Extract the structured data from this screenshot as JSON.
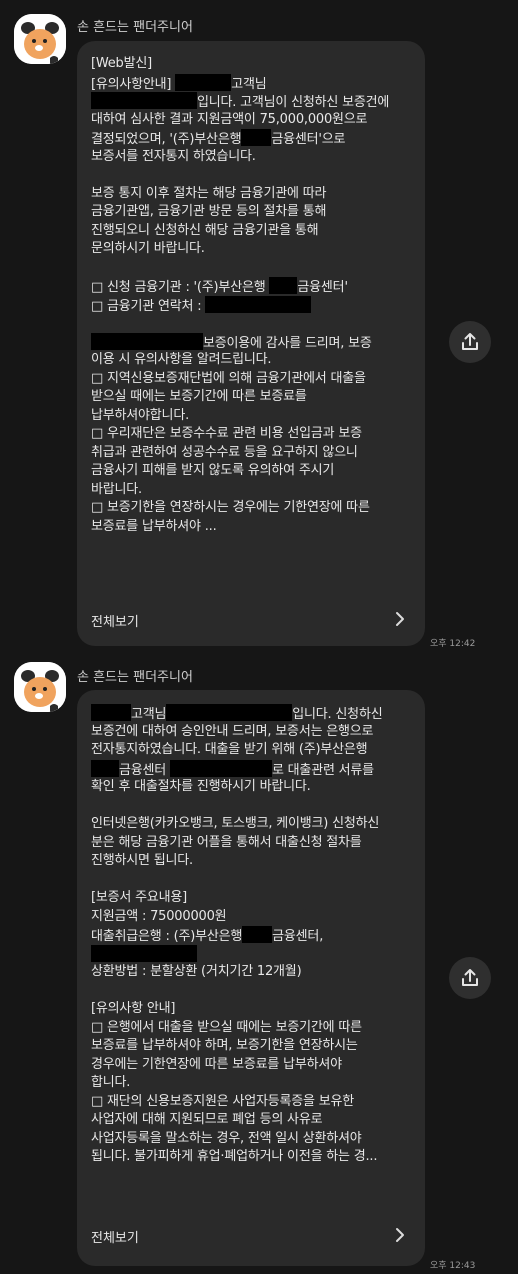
{
  "messages": [
    {
      "sender": "손 흔드는 팬더주니어",
      "time": "오후 12:42",
      "see_all": "전체보기",
      "lines": [
        [
          "[Web발신]"
        ],
        [
          "[유의사항안내] ",
          "R",
          "고객님"
        ],
        [
          "R",
          "입니다. 고객님이 신청하신 보증건에"
        ],
        [
          "대하여 심사한 결과 지원금액이 75,000,000원으로"
        ],
        [
          "결정되었으며, '(주)부산은행",
          "R",
          "금융센터'으로"
        ],
        [
          "보증서를 전자통지 하였습니다."
        ],
        [
          ""
        ],
        [
          "보증 통지 이후 절차는 해당 금융기관에 따라"
        ],
        [
          "금융기관앱, 금융기관 방문 등의 절차를 통해"
        ],
        [
          "진행되오니 신청하신 해당 금융기관을 통해"
        ],
        [
          "문의하시기 바랍니다."
        ],
        [
          ""
        ],
        [
          "□ 신청 금융기관 : '(주)부산은행 ",
          "R",
          "금융센터'"
        ],
        [
          "□ 금융기관 연락처 : ",
          "R"
        ],
        [
          ""
        ],
        [
          "R",
          "보증이용에 감사를 드리며, 보증"
        ],
        [
          "이용 시 유의사항을 알려드립니다."
        ],
        [
          "□ 지역신용보증재단법에 의해 금융기관에서 대출을"
        ],
        [
          "받으실 때에는 보증기간에 따른 보증료를"
        ],
        [
          "납부하셔야합니다."
        ],
        [
          "□ 우리재단은 보증수수료 관련 비용 선입금과 보증"
        ],
        [
          "취급과 관련하여 성공수수료 등을 요구하지 않으니"
        ],
        [
          "금융사기 피해를 받지 않도록 유의하여 주시기"
        ],
        [
          "바랍니다."
        ],
        [
          "□ 보증기한을 연장하시는 경우에는 기한연장에 따른"
        ],
        [
          "보증료를 납부하셔야 ..."
        ]
      ]
    },
    {
      "sender": "손 흔드는 팬더주니어",
      "time": "오후 12:43",
      "see_all": "전체보기",
      "lines": [
        [
          "R",
          "고객님",
          "R",
          "입니다. 신청하신"
        ],
        [
          "보증건에 대하여 승인안내 드리며, 보증서는 은행으로"
        ],
        [
          "전자통지하였습니다. 대출을 받기 위해 (주)부산은행"
        ],
        [
          "R",
          "금융센터 ",
          "R",
          "로 대출관련 서류를"
        ],
        [
          "확인 후 대출절차를 진행하시기 바랍니다."
        ],
        [
          ""
        ],
        [
          "인터넷은행(카카오뱅크, 토스뱅크, 케이뱅크) 신청하신"
        ],
        [
          "분은 해당 금융기관 어플을 통해서 대출신청 절차를"
        ],
        [
          "진행하시면 됩니다."
        ],
        [
          ""
        ],
        [
          "[보증서 주요내용]"
        ],
        [
          "지원금액 : 75000000원"
        ],
        [
          "대출취급은행 : (주)부산은행",
          "R",
          "금융센터,"
        ],
        [
          "R"
        ],
        [
          "상환방법 : 분할상환 (거치기간 12개월)"
        ],
        [
          ""
        ],
        [
          "[유의사항 안내]"
        ],
        [
          "□ 은행에서 대출을 받으실 때에는 보증기간에 따른"
        ],
        [
          "보증료를 납부하셔야 하며, 보증기한을 연장하시는"
        ],
        [
          "경우에는 기한연장에 따른 보증료를 납부하셔야"
        ],
        [
          "합니다."
        ],
        [
          "□ 재단의 신용보증지원은 사업자등록증을 보유한"
        ],
        [
          "사업자에 대해 지원되므로 폐업 등의 사유로"
        ],
        [
          "사업자등록을 말소하는 경우, 전액 일시 상환하셔야"
        ],
        [
          "됩니다. 불가피하게 휴업·폐업하거나 이전을 하는 경..."
        ]
      ]
    }
  ]
}
